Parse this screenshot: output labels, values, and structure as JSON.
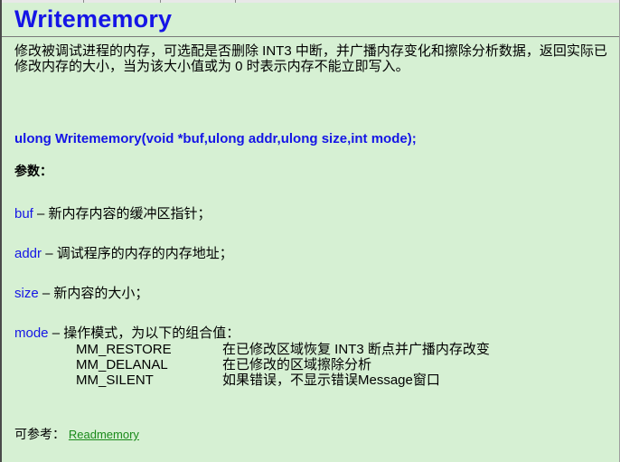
{
  "page": {
    "title": "Writememory",
    "description": "修改被调试进程的内存，可选配是否删除 INT3 中断，并广播内存变化和擦除分析数据，返回实际已修改内存的大小，当为该大小值或为 0 时表示内存不能立即写入。",
    "signature": "ulong Writememory(void *buf,ulong addr,ulong size,int mode);",
    "params_label": "参数：",
    "params": [
      {
        "name": "buf",
        "sep": " – ",
        "desc": "新内存内容的缓冲区指针；"
      },
      {
        "name": "addr",
        "sep": " – ",
        "desc": "调试程序的内存的内存地址；"
      },
      {
        "name": "size",
        "sep": " – ",
        "desc": "新内容的大小；"
      },
      {
        "name": "mode",
        "sep": " – ",
        "desc": "操作模式，为以下的组合值："
      }
    ],
    "modes": [
      {
        "name": "MM_RESTORE",
        "desc": "在已修改区域恢复 INT3 断点并广播内存改变"
      },
      {
        "name": "MM_DELANAL",
        "desc": "在已修改的区域擦除分析"
      },
      {
        "name": "MM_SILENT",
        "desc": "如果错误，不显示错误Message窗口"
      }
    ],
    "see_also_label": "可参考：",
    "see_also_link": "Readmemory"
  },
  "colors": {
    "background": "#d6f0d3",
    "title": "#1515e6",
    "link": "#1a8a1a"
  }
}
